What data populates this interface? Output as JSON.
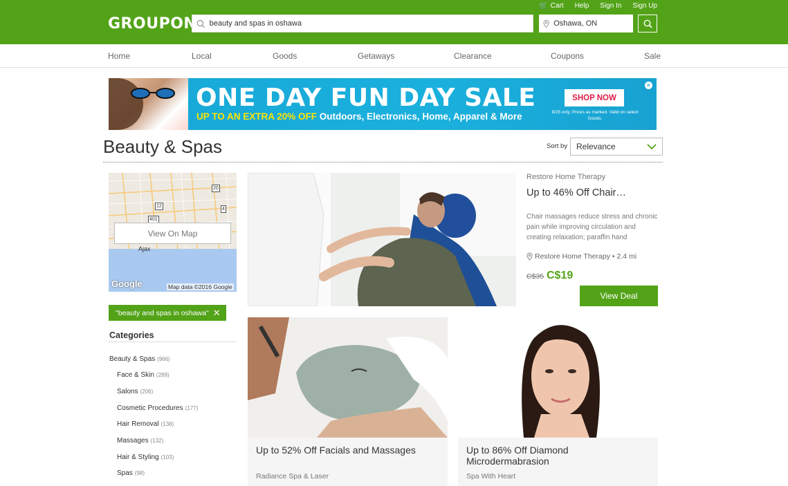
{
  "header": {
    "logo": "GROUPON",
    "links": {
      "cart": "Cart",
      "help": "Help",
      "sign_in": "Sign In",
      "sign_up": "Sign Up"
    },
    "search_value": "beauty and spas in oshawa",
    "location_value": "Oshawa, ON"
  },
  "nav": [
    "Home",
    "Local",
    "Goods",
    "Getaways",
    "Clearance",
    "Coupons",
    "Sale"
  ],
  "banner": {
    "title": "ONE DAY FUN DAY SALE",
    "sub_highlight": "UP TO AN EXTRA 20% OFF",
    "sub_rest": "Outdoors, Electronics, Home, Apparel & More",
    "cta": "SHOP NOW",
    "fine_print": "8/25 only. Prices as marked. Valid on select Goods."
  },
  "page": {
    "title": "Beauty & Spas",
    "sort_label": "Sort by",
    "sort_value": "Relevance"
  },
  "sidebar": {
    "map_button": "View On Map",
    "map_credit": "Map data ©2016 Google",
    "map_logo": "Google",
    "map_town": "Ajax",
    "route_labels": [
      "20",
      "12",
      "4",
      "401"
    ],
    "filter_chip": "\"beauty and spas in oshawa\"",
    "categories_heading": "Categories",
    "categories": [
      {
        "name": "Beauty & Spas",
        "count": "(966)"
      },
      {
        "name": "Face & Skin",
        "count": "(289)"
      },
      {
        "name": "Salons",
        "count": "(206)"
      },
      {
        "name": "Cosmetic Procedures",
        "count": "(177)"
      },
      {
        "name": "Hair Removal",
        "count": "(138)"
      },
      {
        "name": "Massages",
        "count": "(132)"
      },
      {
        "name": "Hair & Styling",
        "count": "(103)"
      },
      {
        "name": "Spas",
        "count": "(98)"
      }
    ]
  },
  "featured_deal": {
    "merchant": "Restore Home Therapy",
    "title": "Up to 46% Off Chair…",
    "description": "Chair massages reduce stress and chronic pain while improving circulation and creating relaxation; paraffin hand",
    "location": "Restore Home Therapy • 2.4 mi",
    "old_price": "C$35",
    "price": "C$19",
    "cta": "View Deal"
  },
  "cards": [
    {
      "title": "Up to 52% Off Facials and Massages",
      "merchant": "Radiance Spa & Laser"
    },
    {
      "title": "Up to 86% Off Diamond Microdermabrasion",
      "merchant": "Spa With Heart"
    }
  ],
  "colors": {
    "brand_green": "#53a318",
    "banner_blue": "#18a2d2",
    "banner_yellow": "#ffe400",
    "cta_red": "#e11d48"
  }
}
